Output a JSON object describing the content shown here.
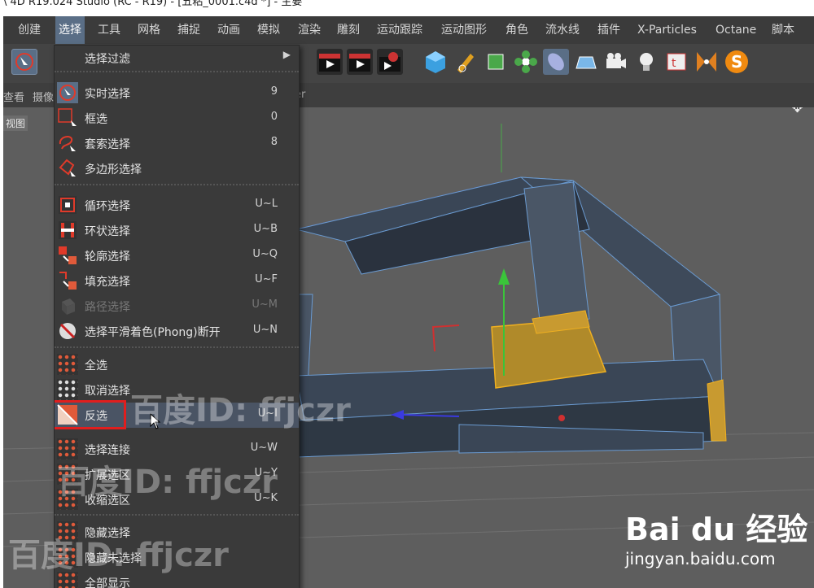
{
  "window": {
    "title": "\\ 4D R19.024 Studio (RC - R19) - [五粘_0001.c4d *] - 主要"
  },
  "menubar": {
    "items": [
      "创建",
      "选择",
      "工具",
      "网格",
      "捕捉",
      "动画",
      "模拟",
      "渲染",
      "雕刻",
      "运动跟踪",
      "运动图形",
      "角色",
      "流水线",
      "插件",
      "X-Particles",
      "Octane",
      "脚本"
    ],
    "active": "选择"
  },
  "subbar": {
    "left1": "查看",
    "left2": "摄像",
    "right": "er"
  },
  "viewport": {
    "label": "视图"
  },
  "dropdown": {
    "items": [
      {
        "label": "选择过滤",
        "shortcut": "",
        "submenu": true
      },
      {
        "label": "实时选择",
        "shortcut": "9"
      },
      {
        "label": "框选",
        "shortcut": "0"
      },
      {
        "label": "套索选择",
        "shortcut": "8"
      },
      {
        "label": "多边形选择",
        "shortcut": ""
      },
      {
        "label": "循环选择",
        "shortcut": "U~L"
      },
      {
        "label": "环状选择",
        "shortcut": "U~B"
      },
      {
        "label": "轮廓选择",
        "shortcut": "U~Q"
      },
      {
        "label": "填充选择",
        "shortcut": "U~F"
      },
      {
        "label": "路径选择",
        "shortcut": "U~M",
        "disabled": true
      },
      {
        "label": "选择平滑着色(Phong)断开",
        "shortcut": "U~N"
      },
      {
        "label": "全选",
        "shortcut": ""
      },
      {
        "label": "取消选择",
        "shortcut": ""
      },
      {
        "label": "反选",
        "shortcut": "U~I"
      },
      {
        "label": "选择连接",
        "shortcut": "U~W"
      },
      {
        "label": "扩展选区",
        "shortcut": "U~Y"
      },
      {
        "label": "收缩选区",
        "shortcut": "U~K"
      },
      {
        "label": "隐藏选择",
        "shortcut": ""
      },
      {
        "label": "隐藏未选择",
        "shortcut": ""
      },
      {
        "label": "全部显示",
        "shortcut": ""
      }
    ],
    "highlighted": "反选"
  },
  "watermarks": {
    "text": "百度ID: ffjczr"
  },
  "brand": {
    "logo": "Bai du 经验",
    "url": "jingyan.baidu.com"
  },
  "colors": {
    "accent": "#5a6e86",
    "highlight": "#e01e1e",
    "selection": "#e0a020"
  }
}
